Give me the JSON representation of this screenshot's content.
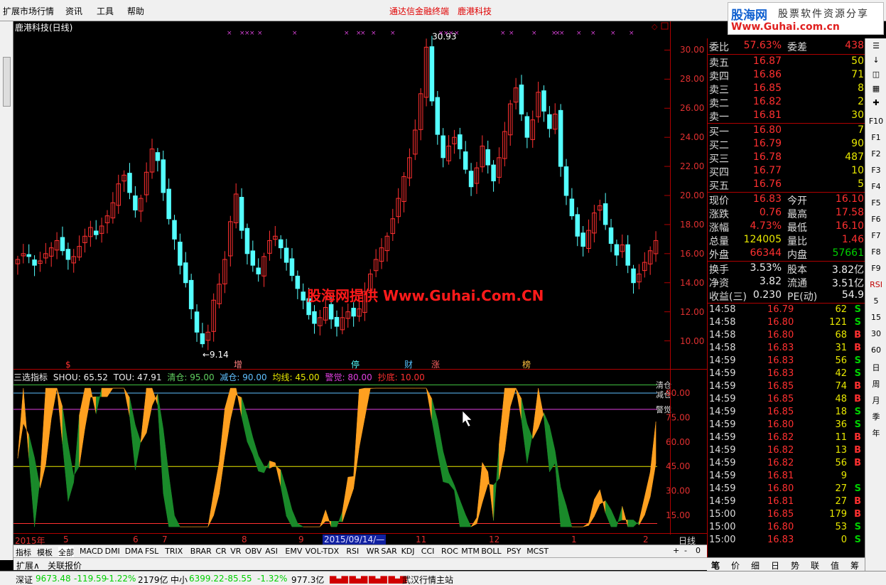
{
  "menu": {
    "items": [
      "扩展市场行情",
      "资讯",
      "工具",
      "帮助"
    ],
    "center_title": "通达信金融终端",
    "center_stock": "鹿港科技"
  },
  "logo": {
    "line1_brand": "股海网",
    "line1_slogan": "股票软件资源分享",
    "line2": "Www.Guhai.com.cn"
  },
  "chart": {
    "title": "鹿港科技(日线)",
    "watermark": "股海网提供 Www.Guhai.Com.CN",
    "high_label": "30.93",
    "low_label": "9.14",
    "price_ticks": [
      "30.00",
      "28.00",
      "26.00",
      "24.00",
      "22.00",
      "20.00",
      "18.00",
      "16.00",
      "14.00",
      "12.00",
      "10.00"
    ],
    "event_markers": [
      "$",
      "增",
      "停",
      "财",
      "涨",
      "榜"
    ],
    "indicator": {
      "name": "三选指标",
      "shou": "SHOU: 65.52",
      "tou": "TOU: 47.91",
      "qingcang": "清仓: 95.00",
      "jiancang": "减仓: 90.00",
      "junxian": "均线: 45.00",
      "jingjue": "警觉: 80.00",
      "chaodi": "抄底: 10.00",
      "right_labels": [
        "清仓",
        "减仓",
        "警觉"
      ],
      "ticks": [
        "90.00",
        "75.00",
        "60.00",
        "45.00",
        "30.00",
        "15.00"
      ]
    },
    "date_axis": {
      "labels": [
        "2015年",
        "5",
        "6",
        "7",
        "8",
        "9",
        "11",
        "12",
        "1",
        "2"
      ],
      "cursor_date": "2015/09/14/—",
      "period": "日线"
    }
  },
  "chart_data": {
    "type": "candlestick",
    "title": "鹿港科技(日线)",
    "ylim": [
      9,
      31
    ],
    "y_ticks": [
      10,
      12,
      14,
      16,
      18,
      20,
      22,
      24,
      26,
      28,
      30
    ],
    "annotations": {
      "high": 30.93,
      "low": 9.14
    },
    "close_series": [
      15.6,
      16.0,
      15.8,
      15.2,
      15.5,
      16.0,
      16.4,
      16.9,
      16.2,
      15.6,
      15.8,
      16.5,
      17.2,
      17.8,
      17.3,
      17.9,
      18.6,
      19.5,
      20.8,
      21.4,
      20.2,
      19.0,
      19.8,
      21.6,
      23.2,
      22.4,
      20.2,
      18.4,
      17.0,
      15.2,
      14.0,
      12.2,
      10.6,
      9.8,
      10.6,
      12.8,
      13.9,
      15.6,
      18.2,
      20.1,
      17.6,
      16.0,
      15.2,
      14.6,
      15.8,
      16.9,
      17.2,
      16.4,
      15.4,
      14.5,
      13.6,
      12.8,
      11.8,
      11.2,
      11.6,
      12.3,
      11.5,
      11.0,
      11.6,
      12.0,
      11.7,
      12.2,
      13.4,
      14.6,
      15.6,
      16.4,
      17.2,
      18.4,
      19.8,
      21.3,
      22.6,
      24.5,
      27.0,
      30.2,
      26.5,
      24.2,
      22.6,
      23.4,
      24.0,
      23.2,
      21.8,
      20.6,
      21.9,
      23.4,
      22.1,
      21.0,
      22.6,
      24.4,
      26.3,
      27.4,
      25.6,
      24.0,
      25.2,
      27.1,
      25.8,
      24.6,
      25.6,
      22.0,
      20.0,
      18.6,
      17.2,
      16.5,
      17.6,
      18.8,
      19.3,
      18.0,
      16.7,
      15.9,
      16.6,
      15.2,
      14.0,
      14.6,
      15.4,
      16.2,
      16.9
    ],
    "indicator": {
      "name": "三选指标",
      "ylim": [
        5,
        100
      ],
      "levels": {
        "清仓": 95.0,
        "减仓": 90.0,
        "警觉": 80.0,
        "均线": 45.0,
        "抄底": 10.0
      },
      "current": {
        "SHOU": 65.52,
        "TOU": 47.91
      }
    }
  },
  "quote": {
    "weibi": {
      "k": "委比",
      "v": "57.63%",
      "k2": "委差",
      "v2": "438"
    },
    "asks": [
      {
        "k": "卖五",
        "p": "16.87",
        "vol": "50"
      },
      {
        "k": "卖四",
        "p": "16.86",
        "vol": "71"
      },
      {
        "k": "卖三",
        "p": "16.85",
        "vol": "8"
      },
      {
        "k": "卖二",
        "p": "16.82",
        "vol": "2"
      },
      {
        "k": "卖一",
        "p": "16.81",
        "vol": "30"
      }
    ],
    "bids": [
      {
        "k": "买一",
        "p": "16.80",
        "vol": "7"
      },
      {
        "k": "买二",
        "p": "16.79",
        "vol": "90"
      },
      {
        "k": "买三",
        "p": "16.78",
        "vol": "487"
      },
      {
        "k": "买四",
        "p": "16.77",
        "vol": "10"
      },
      {
        "k": "买五",
        "p": "16.76",
        "vol": "5"
      }
    ],
    "stats1": [
      {
        "k": "现价",
        "v": "16.83",
        "vc": "red",
        "k2": "今开",
        "v2": "16.10",
        "v2c": "red"
      },
      {
        "k": "涨跌",
        "v": "0.76",
        "vc": "red",
        "k2": "最高",
        "v2": "17.58",
        "v2c": "red"
      },
      {
        "k": "涨幅",
        "v": "4.73%",
        "vc": "red",
        "k2": "最低",
        "v2": "16.10",
        "v2c": "red"
      },
      {
        "k": "总量",
        "v": "124005",
        "vc": "yellow",
        "k2": "量比",
        "v2": "1.46",
        "v2c": "red"
      },
      {
        "k": "外盘",
        "v": "66344",
        "vc": "red",
        "k2": "内盘",
        "v2": "57661",
        "v2c": "green"
      }
    ],
    "stats2": [
      {
        "k": "换手",
        "v": "3.53%",
        "vc": "white",
        "k2": "股本",
        "v2": "3.82亿",
        "v2c": "white"
      },
      {
        "k": "净资",
        "v": "3.82",
        "vc": "white",
        "k2": "流通",
        "v2": "3.51亿",
        "v2c": "white"
      },
      {
        "k": "收益(三)",
        "v": "0.230",
        "vc": "white",
        "k2": "PE(动)",
        "v2": "54.9",
        "v2c": "white"
      }
    ],
    "ticks": [
      {
        "t": "14:58",
        "p": "16.79",
        "pc": "red",
        "vol": "62",
        "d": "S"
      },
      {
        "t": "14:58",
        "p": "16.80",
        "pc": "red",
        "vol": "121",
        "d": "S"
      },
      {
        "t": "14:58",
        "p": "16.80",
        "pc": "red",
        "vol": "68",
        "d": "B"
      },
      {
        "t": "14:58",
        "p": "16.83",
        "pc": "red",
        "vol": "31",
        "d": "B"
      },
      {
        "t": "14:59",
        "p": "16.83",
        "pc": "red",
        "vol": "56",
        "d": "S"
      },
      {
        "t": "14:59",
        "p": "16.83",
        "pc": "red",
        "vol": "42",
        "d": "S"
      },
      {
        "t": "14:59",
        "p": "16.85",
        "pc": "red",
        "vol": "74",
        "d": "B"
      },
      {
        "t": "14:59",
        "p": "16.85",
        "pc": "red",
        "vol": "48",
        "d": "B"
      },
      {
        "t": "14:59",
        "p": "16.85",
        "pc": "red",
        "vol": "18",
        "d": "S"
      },
      {
        "t": "14:59",
        "p": "16.80",
        "pc": "red",
        "vol": "36",
        "d": "S"
      },
      {
        "t": "14:59",
        "p": "16.82",
        "pc": "red",
        "vol": "11",
        "d": "B"
      },
      {
        "t": "14:59",
        "p": "16.82",
        "pc": "red",
        "vol": "13",
        "d": "B"
      },
      {
        "t": "14:59",
        "p": "16.82",
        "pc": "red",
        "vol": "56",
        "d": "B"
      },
      {
        "t": "14:59",
        "p": "16.81",
        "pc": "red",
        "vol": "9",
        "d": ""
      },
      {
        "t": "14:59",
        "p": "16.80",
        "pc": "red",
        "vol": "27",
        "d": "S"
      },
      {
        "t": "14:59",
        "p": "16.81",
        "pc": "red",
        "vol": "27",
        "d": "B"
      },
      {
        "t": "15:00",
        "p": "16.85",
        "pc": "red",
        "vol": "179",
        "d": "B"
      },
      {
        "t": "15:00",
        "p": "16.80",
        "pc": "red",
        "vol": "53",
        "d": "S"
      },
      {
        "t": "15:00",
        "p": "16.83",
        "pc": "red",
        "vol": "0",
        "d": "S"
      }
    ]
  },
  "right_tabs": [
    "笔",
    "价",
    "细",
    "日",
    "势",
    "联",
    "值",
    "筹"
  ],
  "toolbar": [
    "F10",
    "F1",
    "F2",
    "F3",
    "F4",
    "F5",
    "F6",
    "F7",
    "F8",
    "F9",
    "RSI",
    "5",
    "15",
    "30",
    "60",
    "日",
    "周",
    "月",
    "季",
    "年"
  ],
  "bottom_tabs": [
    "指标",
    "模板",
    "全部",
    "MACD",
    "DMI",
    "DMA",
    "FSL",
    "TRIX",
    "BRAR",
    "CR",
    "VR",
    "OBV",
    "ASI",
    "EMV",
    "VOL-TDX",
    "RSI",
    "WR",
    "SAR",
    "KDJ",
    "CCI",
    "ROC",
    "MTM",
    "BOLL",
    "PSY",
    "MCST"
  ],
  "bottom2": [
    "扩展∧",
    "关联报价"
  ],
  "status": {
    "sz_label": "深证",
    "sz_value": "9673.48",
    "sz_change": "-119.59",
    "sz_pct": "-1.22%",
    "sz_amount": "2179亿",
    "zx_label": "中小",
    "zx_value": "6399.22",
    "zx_change": "-85.55",
    "zx_pct": "-1.32%",
    "zx_amount": "977.3亿",
    "station": "武汉行情主站"
  },
  "colors": {
    "up": "#ff3030",
    "down": "#54ffff",
    "orange": "#ffa020",
    "green_fill": "#1a8a2a",
    "accent_red": "#b00000"
  }
}
